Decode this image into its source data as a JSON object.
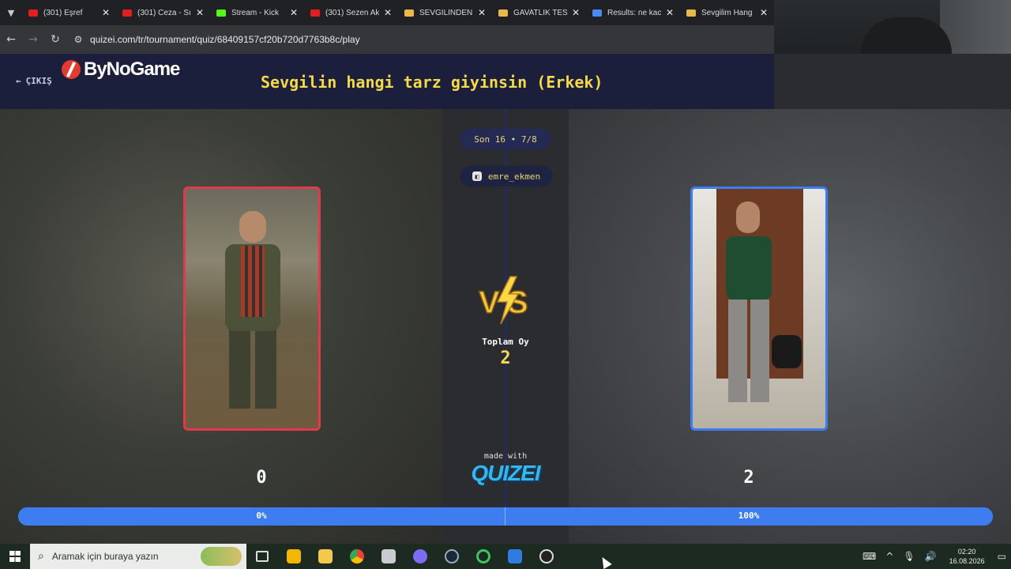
{
  "browser": {
    "tabs": [
      {
        "title": "(301) Eşref",
        "fav_color": "#e02020"
      },
      {
        "title": "(301) Ceza - Sı",
        "fav_color": "#e02020"
      },
      {
        "title": "Stream - Kick",
        "fav_color": "#53fc18"
      },
      {
        "title": "(301) Sezen Ak",
        "fav_color": "#e02020"
      },
      {
        "title": "SEVGİLİNDEN",
        "fav_color": "#e8b84a"
      },
      {
        "title": "GAVATLIK TEST",
        "fav_color": "#e8b84a"
      },
      {
        "title": "Results: ne kac",
        "fav_color": "#4a8af4"
      },
      {
        "title": "Sevgilim Hang",
        "fav_color": "#e8b84a"
      }
    ],
    "url": "quizei.com/tr/tournament/quiz/68409157cf20b720d7763b8c/play"
  },
  "header": {
    "back_label": "ÇIKIŞ",
    "brand": "ByNoGame",
    "title": "Sevgilin hangi tarz giyinsin (Erkek)"
  },
  "round": {
    "label": "Son 16 • 7/8",
    "user": "emre_ekmen"
  },
  "vs": {
    "total_label": "Toplam Oy",
    "total_value": "2"
  },
  "options": {
    "left": {
      "votes": "0",
      "percent": "0%",
      "percent_value": 0
    },
    "right": {
      "votes": "2",
      "percent": "100%",
      "percent_value": 100
    }
  },
  "footer": {
    "made_with": "made with",
    "brand": "QUIZEI"
  },
  "taskbar": {
    "search_placeholder": "Aramak için buraya yazın",
    "time": "02:20",
    "date": "16.08.2026"
  },
  "colors": {
    "accent_yellow": "#f4d94a",
    "left_border": "#e03a4c",
    "right_border": "#3d7df0",
    "header_bg": "#1c1f3b"
  }
}
